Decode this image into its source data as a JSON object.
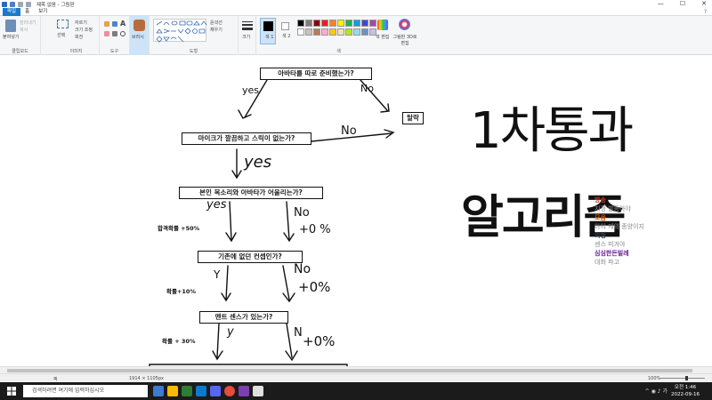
{
  "titlebar": {
    "title": "제목 없음 - 그림판",
    "min_label": "—",
    "max_label": "☐",
    "close_label": "✕"
  },
  "ribbon_tabs": [
    {
      "label": "파일"
    },
    {
      "label": "홈"
    },
    {
      "label": "보기"
    }
  ],
  "ribbon": {
    "clipboard": {
      "paste": "붙여넣기",
      "cut": "잘라내기",
      "copy": "복사",
      "group_label": "클립보드"
    },
    "image": {
      "select": "선택",
      "crop": "자르기",
      "resize": "크기 조정",
      "rotate": "회전",
      "group_label": "이미지"
    },
    "tools": {
      "group_label": "도구"
    },
    "brushes": {
      "label": "브러시"
    },
    "shapes": {
      "outline": "윤곽선",
      "fill": "채우기",
      "group_label": "도형"
    },
    "size": {
      "label": "크기"
    },
    "colors": {
      "color1": "색 1",
      "color2": "색 2",
      "edit": "색 편집",
      "paint3d": "그림판 3D로 편집",
      "group_label": "색",
      "palette": [
        "#000000",
        "#7f7f7f",
        "#880015",
        "#ed1c24",
        "#ff7f27",
        "#fff200",
        "#22b14c",
        "#00a2e8",
        "#3f48cc",
        "#a349a4",
        "#ffffff",
        "#c3c3c3",
        "#b97a57",
        "#ffaec9",
        "#ffc90e",
        "#efe4b0",
        "#b5e61d",
        "#99d9ea",
        "#7092be",
        "#c8bfe7"
      ]
    }
  },
  "flowchart": {
    "q1": "아바타를 따로 준비했는가?",
    "yes1": "yes",
    "no1": "No",
    "fail": "탈락",
    "q2": "마이크가 깔끔하고 스릭이 없는가?",
    "no2": "No",
    "yes2": "yes",
    "q3": "본인 목소리와 아바타가 어울리는가?",
    "yes3": "yes",
    "no3": "No",
    "no3_pct": "+0 %",
    "note3": "합격확률 +50%",
    "q4": "기존에 없던 컨셉인가?",
    "yes4": "Y",
    "no4": "No",
    "no4_pct": "+0%",
    "note4": "확률+10%",
    "q5": "멘트 센스가 있는가?",
    "yes5": "y",
    "no5": "N",
    "no5_pct": "+0%",
    "note5": "확률 + 30%",
    "handwriting1": "1차통과",
    "handwriting2": "알고리즘"
  },
  "overlay_list": [
    {
      "text": "방송",
      "color": "#c0392b"
    },
    {
      "text": "지정 발등아야",
      "color": "#888888"
    },
    {
      "text": "모음",
      "color": "#d35400"
    },
    {
      "text": "아야 제의 종양이지",
      "color": "#888888"
    },
    {
      "text": "외형",
      "color": "#2c3e50"
    },
    {
      "text": "센스 피겨야",
      "color": "#888888"
    },
    {
      "text": "심심한든빌레",
      "color": "#6a1b9a"
    },
    {
      "text": "대화 파고",
      "color": "#888888"
    }
  ],
  "statusbar": {
    "pos_label": "픽",
    "size_label": "1914 × 1105px",
    "zoom": "100%"
  },
  "taskbar": {
    "search_placeholder": "검색하려면 여기에 입력하십시오",
    "time": "오전 1:46",
    "date": "2022-09-16"
  }
}
